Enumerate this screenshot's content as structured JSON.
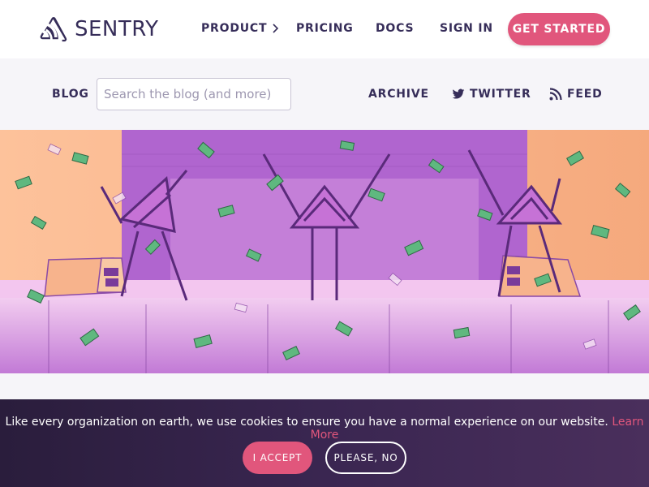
{
  "brand": {
    "name": "SENTRY",
    "logo_icon": "sentry-logo-icon"
  },
  "topnav": {
    "links": [
      {
        "label": "PRODUCT",
        "icon": "chevron-right-icon"
      },
      {
        "label": "PRICING"
      },
      {
        "label": "DOCS"
      },
      {
        "label": "SIGN IN"
      }
    ],
    "cta_label": "GET STARTED"
  },
  "blogbar": {
    "label": "BLOG",
    "search": {
      "placeholder": "Search the blog (and more)",
      "value": ""
    },
    "links": [
      {
        "label": "ARCHIVE"
      },
      {
        "label": "TWITTER",
        "icon": "twitter-icon"
      },
      {
        "label": "FEED",
        "icon": "rss-icon"
      }
    ]
  },
  "hero": {
    "image": "hero-illustration",
    "description_alt": "Three Sentry game-show contestants on a stage with money raining down"
  },
  "cookie_banner": {
    "message": "Like every organization on earth, we use cookies to ensure you have a normal experience on our website.",
    "link_label": "Learn More",
    "accept_label": "I ACCEPT",
    "decline_label": "PLEASE, NO"
  },
  "colors": {
    "brand_dark": "#362d59",
    "accent_pink": "#e1567c",
    "bar_bg": "#f6f5f9",
    "hero_purple": "#b86ccf",
    "hero_peach": "#fbb58a",
    "money_green": "#5fb87f",
    "banner_bg": "#2f2142"
  }
}
